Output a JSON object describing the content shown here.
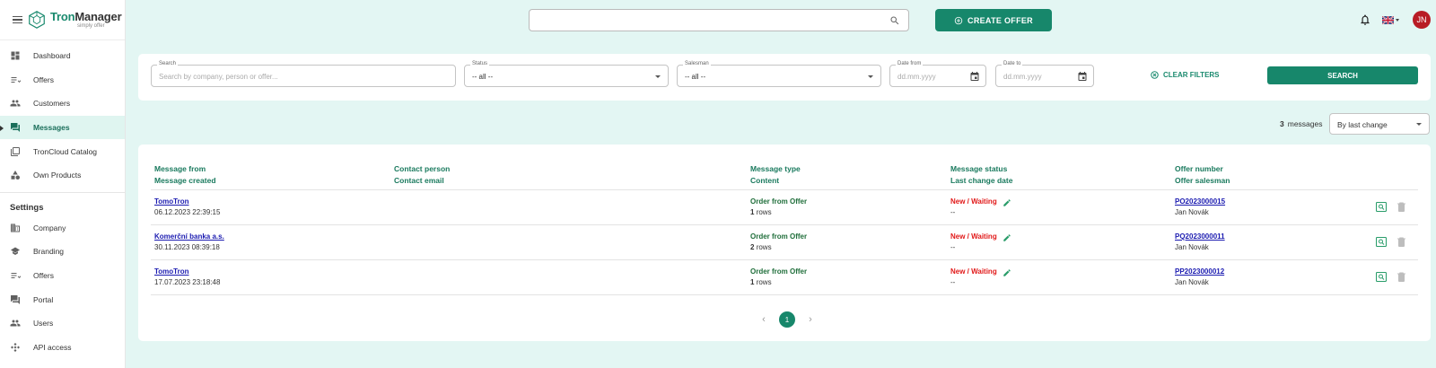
{
  "brand": {
    "name_part1": "Tron",
    "name_part2": "Manager",
    "tagline": "simply offer"
  },
  "nav": {
    "main": [
      {
        "label": "Dashboard",
        "icon": "dashboard-icon"
      },
      {
        "label": "Offers",
        "icon": "offers-icon"
      },
      {
        "label": "Customers",
        "icon": "customers-icon"
      },
      {
        "label": "Messages",
        "icon": "messages-icon",
        "active": true
      },
      {
        "label": "TronCloud Catalog",
        "icon": "catalog-icon"
      },
      {
        "label": "Own Products",
        "icon": "products-icon"
      }
    ],
    "settings_title": "Settings",
    "settings": [
      {
        "label": "Company",
        "icon": "company-icon"
      },
      {
        "label": "Branding",
        "icon": "branding-icon"
      },
      {
        "label": "Offers",
        "icon": "offers-icon"
      },
      {
        "label": "Portal",
        "icon": "portal-icon"
      },
      {
        "label": "Users",
        "icon": "users-icon"
      },
      {
        "label": "API access",
        "icon": "api-icon"
      }
    ]
  },
  "topbar": {
    "search_value": "",
    "create_label": "CREATE OFFER",
    "avatar_initials": "JN",
    "language": "en-gb-flag-icon"
  },
  "filters": {
    "search_label": "Search",
    "search_placeholder": "Search by company, person or offer...",
    "status_label": "Status",
    "status_value": "-- all --",
    "salesman_label": "Salesman",
    "salesman_value": "-- all --",
    "date_from_label": "Date from",
    "date_from_placeholder": "dd.mm.yyyy",
    "date_to_label": "Date to",
    "date_to_placeholder": "dd.mm.yyyy",
    "clear_label": "CLEAR FILTERS",
    "search_button": "SEARCH"
  },
  "list": {
    "count": "3",
    "count_label": "messages",
    "sort_value": "By last change"
  },
  "table": {
    "headers": {
      "from": "Message from",
      "created": "Message created",
      "contact_person": "Contact person",
      "contact_email": "Contact email",
      "type": "Message type",
      "content": "Content",
      "status": "Message status",
      "last_change": "Last change date",
      "offer_number": "Offer number",
      "offer_salesman": "Offer salesman"
    },
    "rows": [
      {
        "from": "TomoTron",
        "created": "06.12.2023 22:39:15",
        "type": "Order from Offer",
        "rows_count": "1",
        "rows_label": "rows",
        "status": "New / Waiting",
        "last_change": "--",
        "offer_number": "PO2023000015",
        "salesman": "Jan Novák"
      },
      {
        "from": "Komerční banka a.s.",
        "created": "30.11.2023 08:39:18",
        "type": "Order from Offer",
        "rows_count": "2",
        "rows_label": "rows",
        "status": "New / Waiting",
        "last_change": "--",
        "offer_number": "PQ2023000011",
        "salesman": "Jan Novák"
      },
      {
        "from": "TomoTron",
        "created": "17.07.2023 23:18:48",
        "type": "Order from Offer",
        "rows_count": "1",
        "rows_label": "rows",
        "status": "New / Waiting",
        "last_change": "--",
        "offer_number": "PP2023000012",
        "salesman": "Jan Novák"
      }
    ]
  },
  "pagination": {
    "current": "1",
    "prev": "‹",
    "next": "›"
  },
  "colors": {
    "accent": "#17876b",
    "status_new": "#e11919",
    "link": "#1a1ab0",
    "background": "#e3f6f3"
  }
}
